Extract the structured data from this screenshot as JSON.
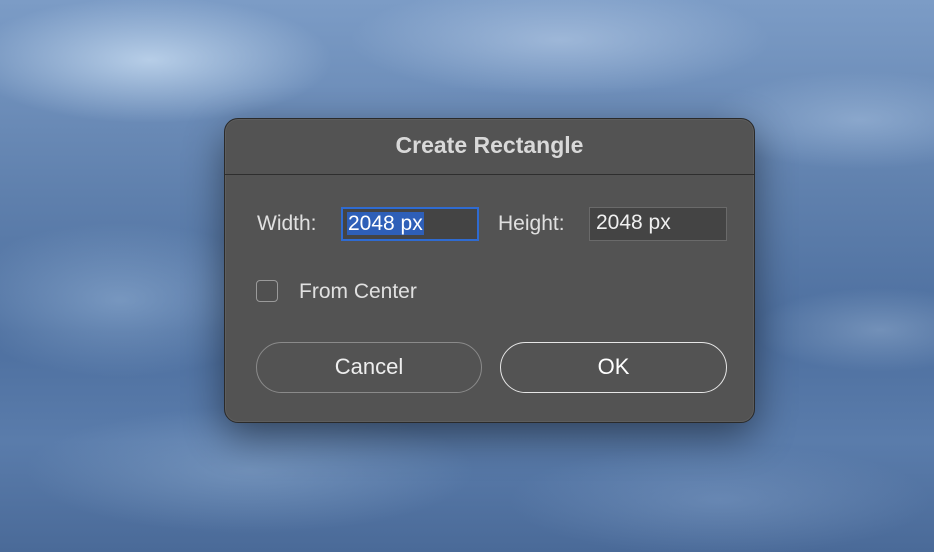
{
  "dialog": {
    "title": "Create Rectangle",
    "width_label": "Width:",
    "width_value": "2048 px",
    "height_label": "Height:",
    "height_value": "2048 px",
    "from_center_label": "From Center",
    "from_center_checked": false,
    "cancel_label": "Cancel",
    "ok_label": "OK"
  },
  "colors": {
    "dialog_bg": "#535353",
    "focus_ring": "#2f6bd1",
    "selection": "#2e5fb8"
  }
}
